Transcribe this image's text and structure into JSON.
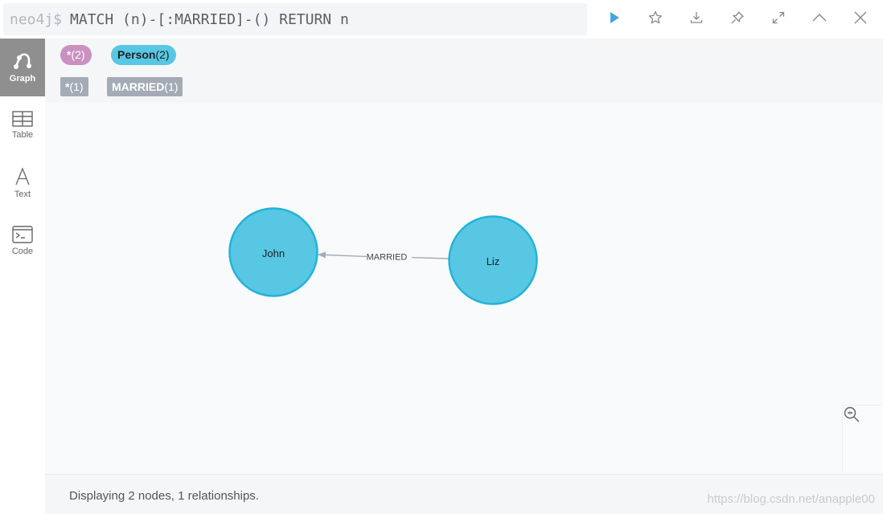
{
  "query": {
    "prompt": "neo4j$",
    "text": "MATCH (n)-[:MARRIED]-() RETURN n"
  },
  "toolbar": {
    "icons": [
      "play-icon",
      "star-icon",
      "download-icon",
      "pin-icon",
      "expand-icon",
      "collapse-up-icon",
      "close-icon"
    ],
    "accent": "#4aa3df"
  },
  "rail": {
    "items": [
      {
        "label": "Graph",
        "active": true
      },
      {
        "label": "Table"
      },
      {
        "label": "Text"
      },
      {
        "label": "Code"
      }
    ]
  },
  "legend": {
    "node_all": {
      "label": "*",
      "count": "(2)",
      "color": "#c990c0"
    },
    "node_person": {
      "label": "Person",
      "count": "(2)",
      "color": "#57c7e3"
    },
    "rel_all": {
      "label": "*",
      "count": "(1)"
    },
    "rel_married": {
      "label": "MARRIED",
      "count": "(1)",
      "color": "#a5abb6"
    }
  },
  "graph": {
    "nodes": [
      {
        "label": "John"
      },
      {
        "label": "Liz"
      }
    ],
    "relationship": {
      "label": "MARRIED"
    },
    "node_color": "#57c7e3",
    "node_stroke": "#23b3d7"
  },
  "status": {
    "text": "Displaying 2 nodes, 1 relationships.",
    "watermark": "https://blog.csdn.net/anapple00"
  }
}
